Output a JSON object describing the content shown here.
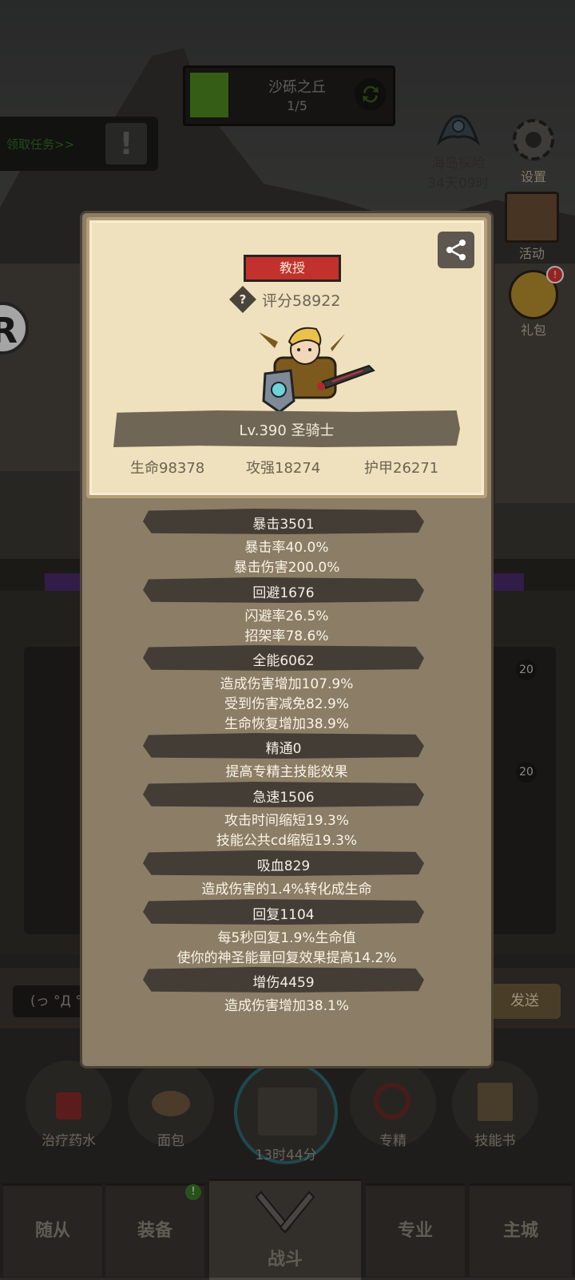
{
  "hud": {
    "stage_name": "沙砾之丘",
    "stage_progress": "1/5",
    "quest_text": "领取任务>>",
    "island_label": "海岛探险",
    "island_timer": "34天09时",
    "settings_label": "设置",
    "event_label": "活动",
    "gift_label": "礼包"
  },
  "dialog": {
    "title_badge": "教授",
    "score": "评分58922",
    "level_class": "Lv.390 圣骑士",
    "core_stats": [
      "生命98378",
      "攻强18274",
      "护甲26271"
    ],
    "stat_groups": [
      {
        "header": "暴击3501",
        "lines": [
          "暴击率40.0%",
          "暴击伤害200.0%"
        ]
      },
      {
        "header": "回避1676",
        "lines": [
          "闪避率26.5%",
          "招架率78.6%"
        ]
      },
      {
        "header": "全能6062",
        "lines": [
          "造成伤害增加107.9%",
          "受到伤害减免82.9%",
          "生命恢复增加38.9%"
        ]
      },
      {
        "header": "精通0",
        "lines": [
          "提高专精主技能效果"
        ]
      },
      {
        "header": "急速1506",
        "lines": [
          "攻击时间缩短19.3%",
          "技能公共cd缩短19.3%"
        ]
      },
      {
        "header": "吸血829",
        "lines": [
          "造成伤害的1.4%转化成生命"
        ]
      },
      {
        "header": "回复1104",
        "lines": [
          "每5秒回复1.9%生命值",
          "使你的神圣能量回复效果提高14.2%"
        ]
      },
      {
        "header": "增伤4459",
        "lines": [
          "造成伤害增加38.1%"
        ]
      }
    ]
  },
  "side": {
    "chat_placeholder": "(っ °Д °",
    "send_label": "发送",
    "slot_badges": [
      "20",
      "20"
    ]
  },
  "actions": [
    {
      "label": "治疗药水"
    },
    {
      "label": "面包"
    },
    {
      "label": "13时44分"
    },
    {
      "label": "专精"
    },
    {
      "label": "技能书"
    }
  ],
  "tabs": [
    {
      "label": "随从"
    },
    {
      "label": "装备"
    },
    {
      "label": "战斗"
    },
    {
      "label": "专业"
    },
    {
      "label": "主城"
    }
  ],
  "colors": {
    "dialog_bg": "#8b7d66",
    "card_bg": "#efe1bd",
    "badge_red": "#c2312c",
    "stat_header": "#433d36",
    "quest_green": "#2f6f2a"
  }
}
